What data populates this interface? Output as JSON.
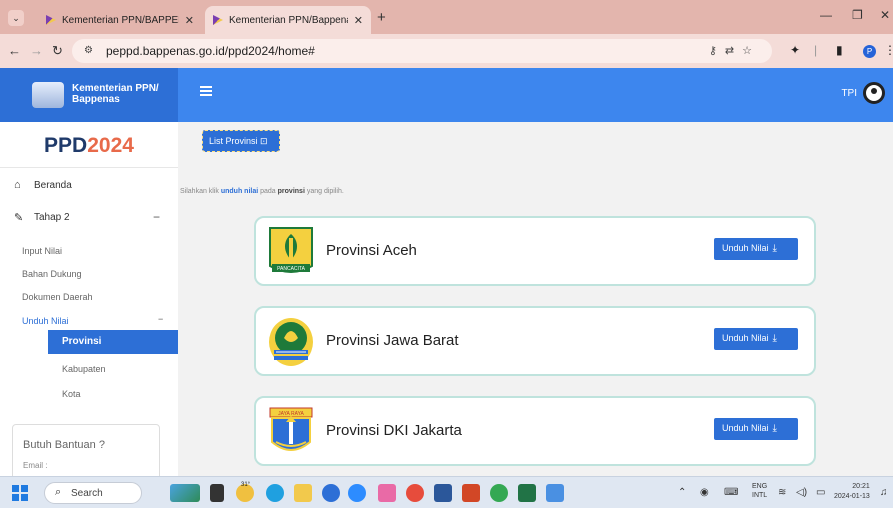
{
  "browser": {
    "tabs": [
      {
        "title": "Kementerian PPN/BAPPENAS :",
        "active": false
      },
      {
        "title": "Kementerian PPN/Bappenas : P",
        "active": true
      }
    ],
    "new_tab": "+",
    "url": "peppd.bappenas.go.id/ppd2024/home#",
    "profile_initial": "P"
  },
  "app": {
    "brand": "Kementerian PPN/ Bappenas",
    "user_label": "TPI",
    "accent": "#2d6fd6"
  },
  "sidebar": {
    "title_prefix": "PPD",
    "title_accent": "2024",
    "items": [
      {
        "label": "Beranda",
        "icon": "home-icon"
      },
      {
        "label": "Tahap 2",
        "icon": "edit-icon"
      }
    ],
    "tahap2_subitems": [
      "Input Nilai",
      "Bahan Dukung",
      "Dokumen Daerah",
      "Unduh Nilai"
    ],
    "unduh_subitems": [
      "Provinsi",
      "Kabupaten",
      "Kota"
    ],
    "help_title": "Butuh Bantuan ?",
    "help_email": "Email :"
  },
  "main": {
    "list_button": "List Provinsi",
    "hint_prefix": "Silahkan klik ",
    "hint_bold1": "unduh nilai",
    "hint_mid": " pada ",
    "hint_bold2": "provinsi",
    "hint_suffix": " yang dipilih.",
    "download_label": "Unduh Nilai",
    "provinces": [
      {
        "name": "Provinsi Aceh",
        "emblem_text": "PANCACITA"
      },
      {
        "name": "Provinsi Jawa Barat"
      },
      {
        "name": "Provinsi DKI Jakarta",
        "emblem_text": "JAYA RAYA"
      }
    ]
  },
  "taskbar": {
    "search_label": "Search",
    "lang_top": "ENG",
    "lang_bottom": "INTL",
    "time": "20:21",
    "date": "2024-01-13",
    "weather": "31°"
  }
}
